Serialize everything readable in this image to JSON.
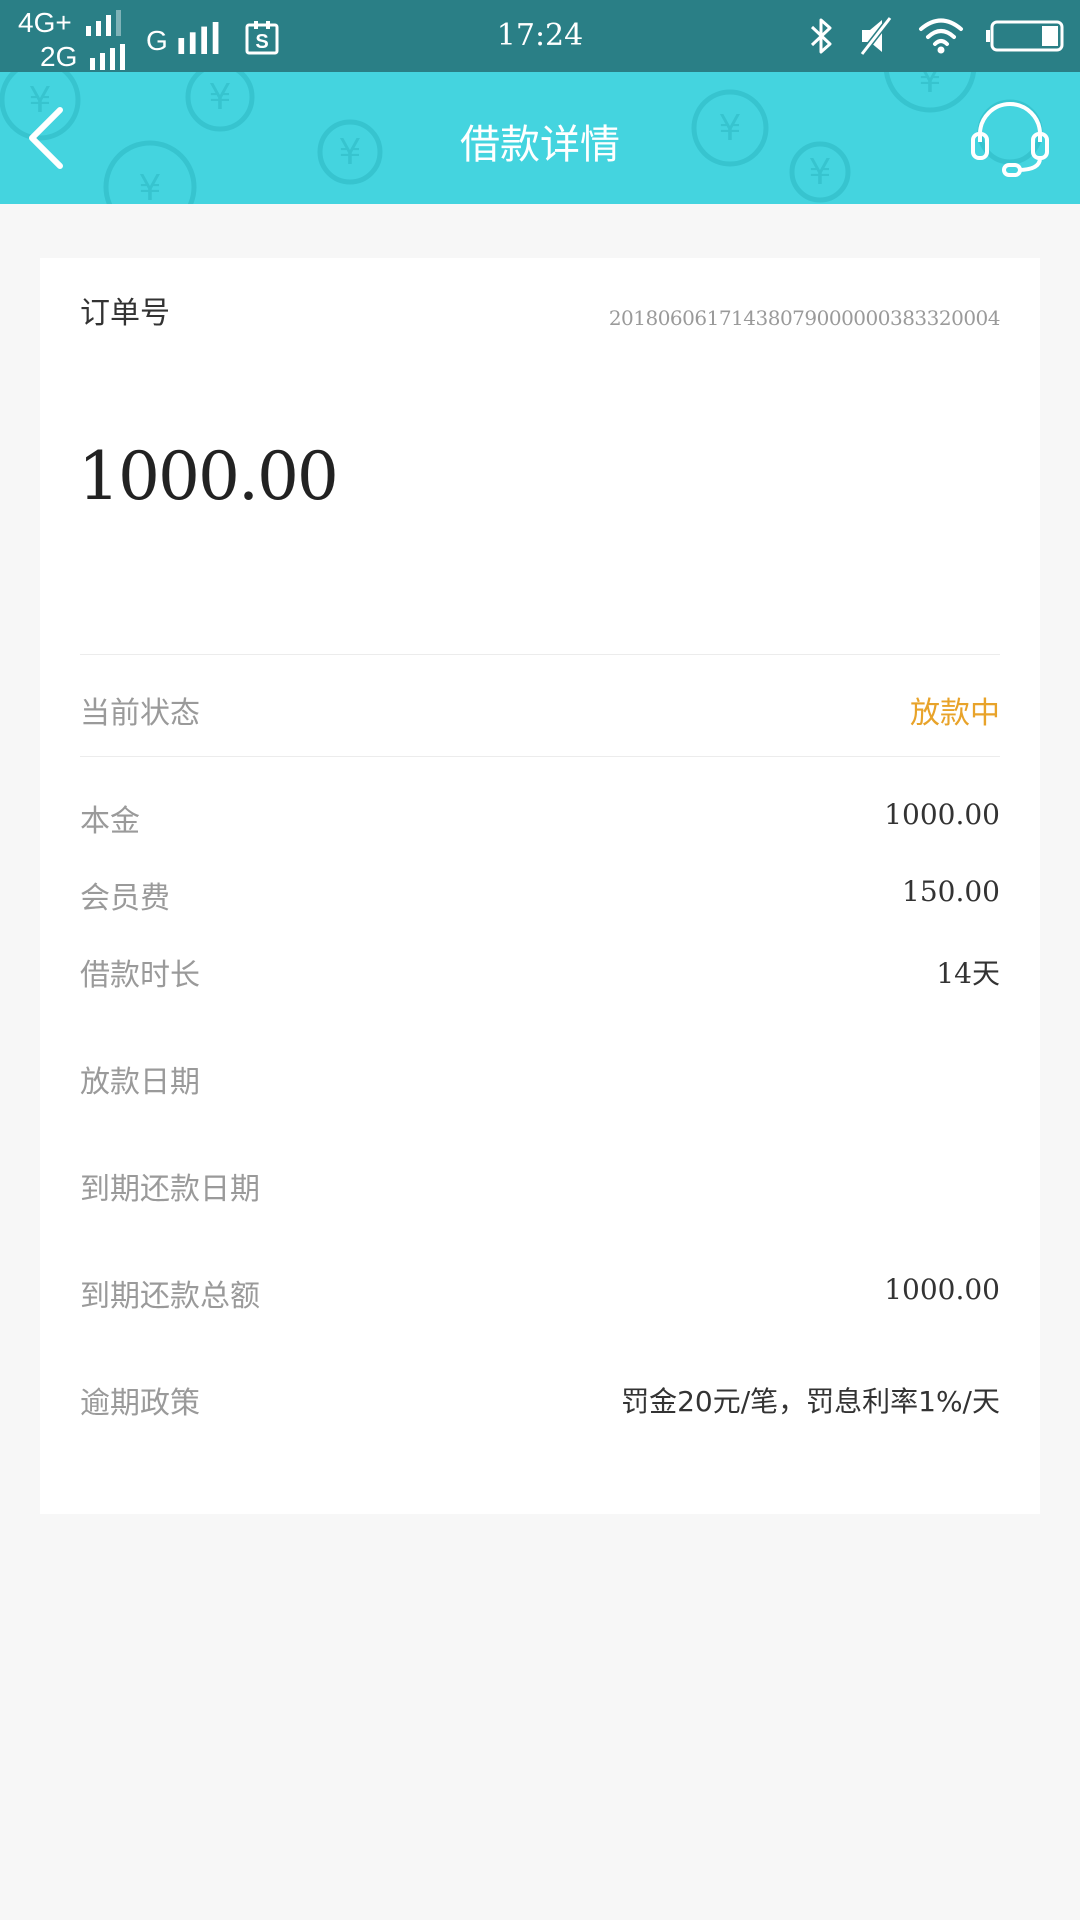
{
  "status_bar": {
    "network_1": "4G+",
    "network_2": "2G",
    "network_3": "G",
    "time": "17:24"
  },
  "header": {
    "title": "借款详情"
  },
  "order": {
    "label": "订单号",
    "value": "20180606171438079000000383320004"
  },
  "amount": "1000.00",
  "status": {
    "label": "当前状态",
    "value": "放款中",
    "color": "#e8a32a"
  },
  "details": [
    {
      "label": "本金",
      "value": "1000.00"
    },
    {
      "label": "会员费",
      "value": "150.00"
    },
    {
      "label": "借款时长",
      "value": "14天"
    },
    {
      "label": "放款日期",
      "value": ""
    },
    {
      "label": "到期还款日期",
      "value": ""
    },
    {
      "label": "到期还款总额",
      "value": "1000.00"
    },
    {
      "label": "逾期政策",
      "value": "罚金20元/笔，罚息利率1%/天"
    }
  ],
  "colors": {
    "status_bar": "#2a7f86",
    "header": "#44d4df",
    "background": "#f7f7f7"
  },
  "icons": {
    "back": "chevron-left-icon",
    "support": "headset-icon",
    "bluetooth": "bluetooth-icon",
    "mute": "mute-icon",
    "wifi": "wifi-icon",
    "battery": "battery-icon",
    "sim_app": "s-app-icon"
  }
}
